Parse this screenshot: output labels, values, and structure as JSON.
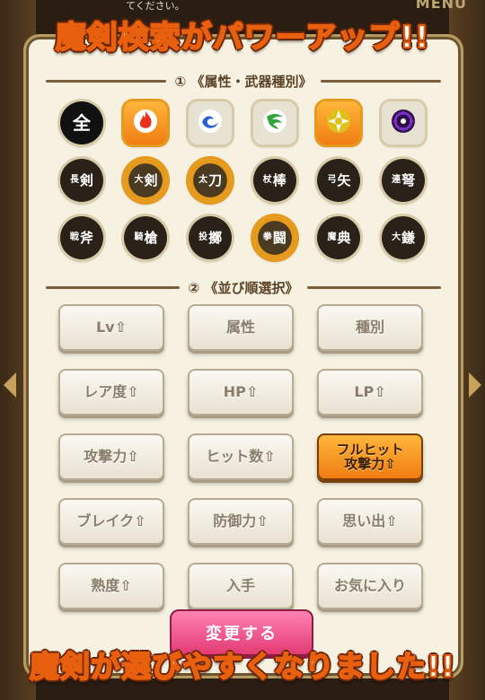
{
  "top_hint": "てください。",
  "menu_label": "MENU",
  "banners": {
    "top": "魔剣検索がパワーアップ!!",
    "bottom": "魔剣が選びやすくなりました!!"
  },
  "section1": {
    "title": "① 《属性・武器種別》"
  },
  "section2": {
    "title": "② 《並び順選択》"
  },
  "elements": [
    {
      "name": "all",
      "label": "全",
      "color": "#111111",
      "selected": false
    },
    {
      "name": "fire",
      "label": "",
      "color": "#e8331c",
      "selected": true
    },
    {
      "name": "water",
      "label": "",
      "color": "#2a62d4",
      "selected": false
    },
    {
      "name": "wind",
      "label": "",
      "color": "#2fa43a",
      "selected": false
    },
    {
      "name": "light",
      "label": "",
      "color": "#e0c11a",
      "selected": true
    },
    {
      "name": "dark",
      "label": "",
      "color": "#7a2fc4",
      "selected": false
    }
  ],
  "weapons_row1": [
    {
      "name": "long-sword",
      "small": "長",
      "main": "剣",
      "selected": false
    },
    {
      "name": "great-sword",
      "small": "大",
      "main": "剣",
      "selected": true
    },
    {
      "name": "katana",
      "small": "太",
      "main": "刀",
      "selected": true
    },
    {
      "name": "staff",
      "small": "杖",
      "main": "棒",
      "selected": false
    },
    {
      "name": "bow",
      "small": "弓",
      "main": "矢",
      "selected": false
    },
    {
      "name": "crossbow",
      "small": "連",
      "main": "弩",
      "selected": false
    }
  ],
  "weapons_row2": [
    {
      "name": "axe",
      "small": "戦",
      "main": "斧",
      "selected": false
    },
    {
      "name": "spear",
      "small": "騎",
      "main": "槍",
      "selected": false
    },
    {
      "name": "throwing",
      "small": "投",
      "main": "擲",
      "selected": false
    },
    {
      "name": "fist",
      "small": "拳",
      "main": "闘",
      "selected": true
    },
    {
      "name": "tome",
      "small": "魔",
      "main": "典",
      "selected": false
    },
    {
      "name": "scythe",
      "small": "大",
      "main": "鎌",
      "selected": false
    }
  ],
  "sort_buttons": [
    {
      "name": "sort-lv",
      "label": "Lv⇧",
      "active": false
    },
    {
      "name": "sort-attribute",
      "label": "属性",
      "active": false
    },
    {
      "name": "sort-type",
      "label": "種別",
      "active": false
    },
    {
      "name": "sort-rarity",
      "label": "レア度⇧",
      "active": false
    },
    {
      "name": "sort-hp",
      "label": "HP⇧",
      "active": false
    },
    {
      "name": "sort-lp",
      "label": "LP⇧",
      "active": false
    },
    {
      "name": "sort-attack",
      "label": "攻撃力⇧",
      "active": false
    },
    {
      "name": "sort-hit-count",
      "label": "ヒット数⇧",
      "active": false
    },
    {
      "name": "sort-full-hit-attack",
      "label": "フルヒット\n攻撃力⇧",
      "active": true
    },
    {
      "name": "sort-break",
      "label": "ブレイク⇧",
      "active": false
    },
    {
      "name": "sort-defense",
      "label": "防御力⇧",
      "active": false
    },
    {
      "name": "sort-memories",
      "label": "思い出⇧",
      "active": false
    },
    {
      "name": "sort-mastery",
      "label": "熟度⇧",
      "active": false
    },
    {
      "name": "sort-acquired",
      "label": "入手",
      "active": false
    },
    {
      "name": "sort-favorite",
      "label": "お気に入り",
      "active": false
    }
  ],
  "change_button": "変更する",
  "colors": {
    "accent_orange": "#f07d12",
    "change_pink": "#e33b74",
    "panel_bg": "#f6f1e1"
  }
}
